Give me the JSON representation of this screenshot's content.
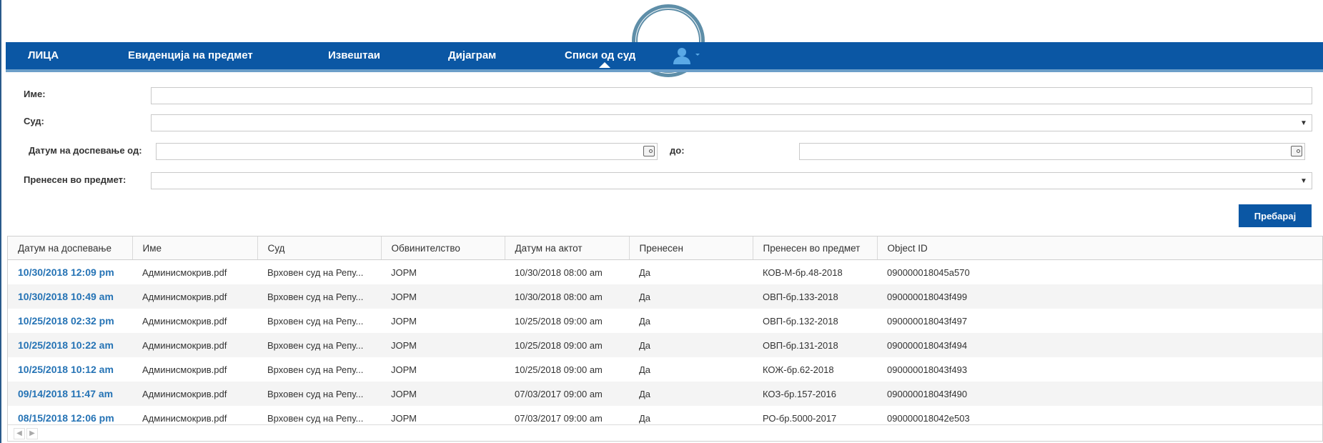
{
  "nav": {
    "items": [
      {
        "label": "ЛИЦА"
      },
      {
        "label": "Евиденција на предмет"
      },
      {
        "label": "Извештаи"
      },
      {
        "label": "Дијаграм"
      },
      {
        "label": "Списи од суд"
      }
    ],
    "active_index": 4,
    "user_icon": "user-icon",
    "user_dropdown_icon": "caret-down-icon"
  },
  "filters": {
    "name_label": "Име:",
    "name_value": "",
    "court_label": "Суд:",
    "court_value": "",
    "due_from_label": "Датум на доспевање од:",
    "due_from_value": "",
    "due_to_label": "до:",
    "due_to_value": "",
    "transferred_label": "Пренесен во предмет:",
    "transferred_value": "",
    "search_button": "Пребарај"
  },
  "table": {
    "columns": [
      "Датум на доспевање",
      "Име",
      "Суд",
      "Обвинителство",
      "Датум на актот",
      "Пренесен",
      "Пренесен во предмет",
      "Object ID"
    ],
    "rows": [
      [
        "10/30/2018 12:09 pm",
        "Админисмокрив.pdf",
        "Врховен суд на Репу...",
        "ЈОРМ",
        "10/30/2018 08:00 am",
        "Да",
        "КОВ-М-бр.48-2018",
        "090000018045a570"
      ],
      [
        "10/30/2018 10:49 am",
        "Админисмокрив.pdf",
        "Врховен суд на Репу...",
        "ЈОРМ",
        "10/30/2018 08:00 am",
        "Да",
        "ОВП-бр.133-2018",
        "090000018043f499"
      ],
      [
        "10/25/2018 02:32 pm",
        "Админисмокрив.pdf",
        "Врховен суд на Репу...",
        "ЈОРМ",
        "10/25/2018 09:00 am",
        "Да",
        "ОВП-бр.132-2018",
        "090000018043f497"
      ],
      [
        "10/25/2018 10:22 am",
        "Админисмокрив.pdf",
        "Врховен суд на Репу...",
        "ЈОРМ",
        "10/25/2018 09:00 am",
        "Да",
        "ОВП-бр.131-2018",
        "090000018043f494"
      ],
      [
        "10/25/2018 10:12 am",
        "Админисмокрив.pdf",
        "Врховен суд на Репу...",
        "ЈОРМ",
        "10/25/2018 09:00 am",
        "Да",
        "КОЖ-бр.62-2018",
        "090000018043f493"
      ],
      [
        "09/14/2018 11:47 am",
        "Админисмокрив.pdf",
        "Врховен суд на Репу...",
        "ЈОРМ",
        "07/03/2017 09:00 am",
        "Да",
        "КОЗ-бр.157-2016",
        "090000018043f490"
      ],
      [
        "08/15/2018 12:06 pm",
        "Админисмокрив.pdf",
        "Врховен суд на Репу...",
        "ЈОРМ",
        "07/03/2017 09:00 am",
        "Да",
        "РО-бр.5000-2017",
        "090000018042e503"
      ]
    ]
  },
  "colors": {
    "nav_bg": "#0b57a4",
    "link": "#2573b5",
    "button_bg": "#0b57a4"
  }
}
